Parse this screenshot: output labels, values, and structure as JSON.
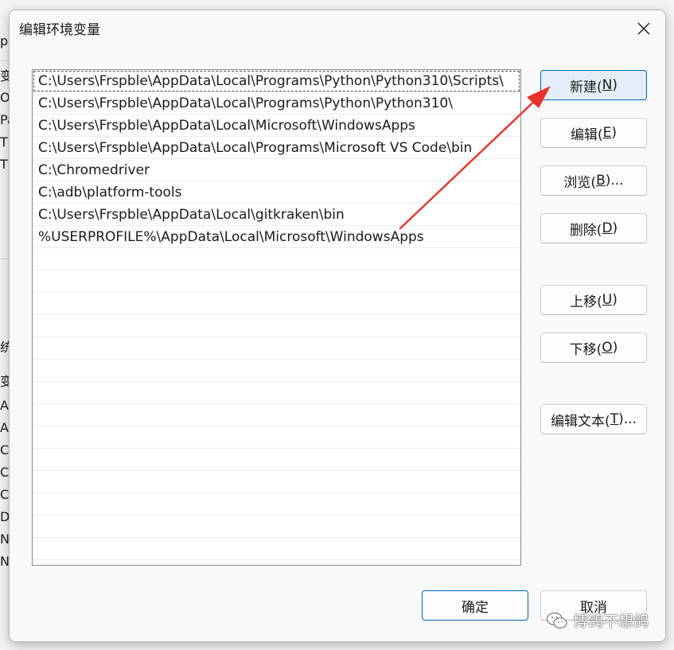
{
  "background_window": {
    "fragments": [
      "p",
      "变",
      "O",
      "Pa",
      "TE",
      "TM",
      "统",
      "变",
      "AC",
      "AC",
      "Co",
      "CU",
      "CU",
      "Dr",
      "N",
      "NI"
    ]
  },
  "dialog": {
    "title": "编辑环境变量",
    "close_icon": "close-icon"
  },
  "paths": [
    "C:\\Users\\Frspble\\AppData\\Local\\Programs\\Python\\Python310\\Scripts\\",
    "C:\\Users\\Frspble\\AppData\\Local\\Programs\\Python\\Python310\\",
    "C:\\Users\\Frspble\\AppData\\Local\\Microsoft\\WindowsApps",
    "C:\\Users\\Frspble\\AppData\\Local\\Programs\\Microsoft VS Code\\bin",
    "C:\\Chromedriver",
    "C:\\adb\\platform-tools",
    "C:\\Users\\Frspble\\AppData\\Local\\gitkraken\\bin",
    "%USERPROFILE%\\AppData\\Local\\Microsoft\\WindowsApps"
  ],
  "buttons": {
    "new": {
      "label": "新建(",
      "mnemonic": "N",
      "suffix": ")"
    },
    "edit": {
      "label": "编辑(",
      "mnemonic": "E",
      "suffix": ")"
    },
    "browse": {
      "label": "浏览(",
      "mnemonic": "B",
      "suffix": ")..."
    },
    "delete": {
      "label": "删除(",
      "mnemonic": "D",
      "suffix": ")"
    },
    "move_up": {
      "label": "上移(",
      "mnemonic": "U",
      "suffix": ")"
    },
    "move_down": {
      "label": "下移(",
      "mnemonic": "O",
      "suffix": ")"
    },
    "edit_text": {
      "label": "编辑文本(",
      "mnemonic": "T",
      "suffix": ")..."
    },
    "ok": "确定",
    "cancel": "取消"
  },
  "watermark": {
    "text": "博鸽不想鸽",
    "icon": "wechat-icon"
  },
  "colors": {
    "accent": "#0067c0",
    "annotation": "#e8332a"
  }
}
